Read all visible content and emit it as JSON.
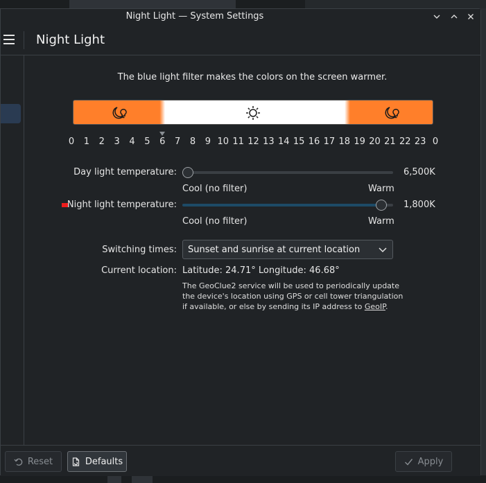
{
  "window": {
    "title": "Night Light — System Settings"
  },
  "header": {
    "page_title": "Night Light"
  },
  "content": {
    "description": "The blue light filter makes the colors on the screen warmer.",
    "timeline": {
      "hours": [
        "0",
        "1",
        "2",
        "3",
        "4",
        "5",
        "6",
        "7",
        "8",
        "9",
        "10",
        "11",
        "12",
        "13",
        "14",
        "15",
        "16",
        "17",
        "18",
        "19",
        "20",
        "21",
        "22",
        "23",
        "0"
      ],
      "marker_hour": 6,
      "night_until_hour": 6,
      "night_from_hour": 18
    },
    "day_temp": {
      "label": "Day light temperature:",
      "value": "6,500K",
      "level": 0,
      "cool_label": "Cool (no filter)",
      "warm_label": "Warm"
    },
    "night_temp": {
      "label": "Night light temperature:",
      "value": "1,800K",
      "level": 0.97,
      "cool_label": "Cool (no filter)",
      "warm_label": "Warm"
    },
    "switching": {
      "label": "Switching times:",
      "selected": "Sunset and sunrise at current location"
    },
    "location": {
      "label": "Current location:",
      "value": "Latitude: 24.71°   Longitude: 46.68°",
      "note": "The GeoClue2 service will be used to periodically update the device's location using GPS or cell tower triangulation if available, or else by sending its IP address to ",
      "link": "GeoIP",
      "note_end": "."
    }
  },
  "footer": {
    "reset_label": "Reset",
    "defaults_label": "Defaults",
    "apply_label": "Apply"
  },
  "colors": {
    "accent_orange": "#ff7f2a",
    "night_indicator": "#ee1c1c",
    "background": "#202326"
  }
}
